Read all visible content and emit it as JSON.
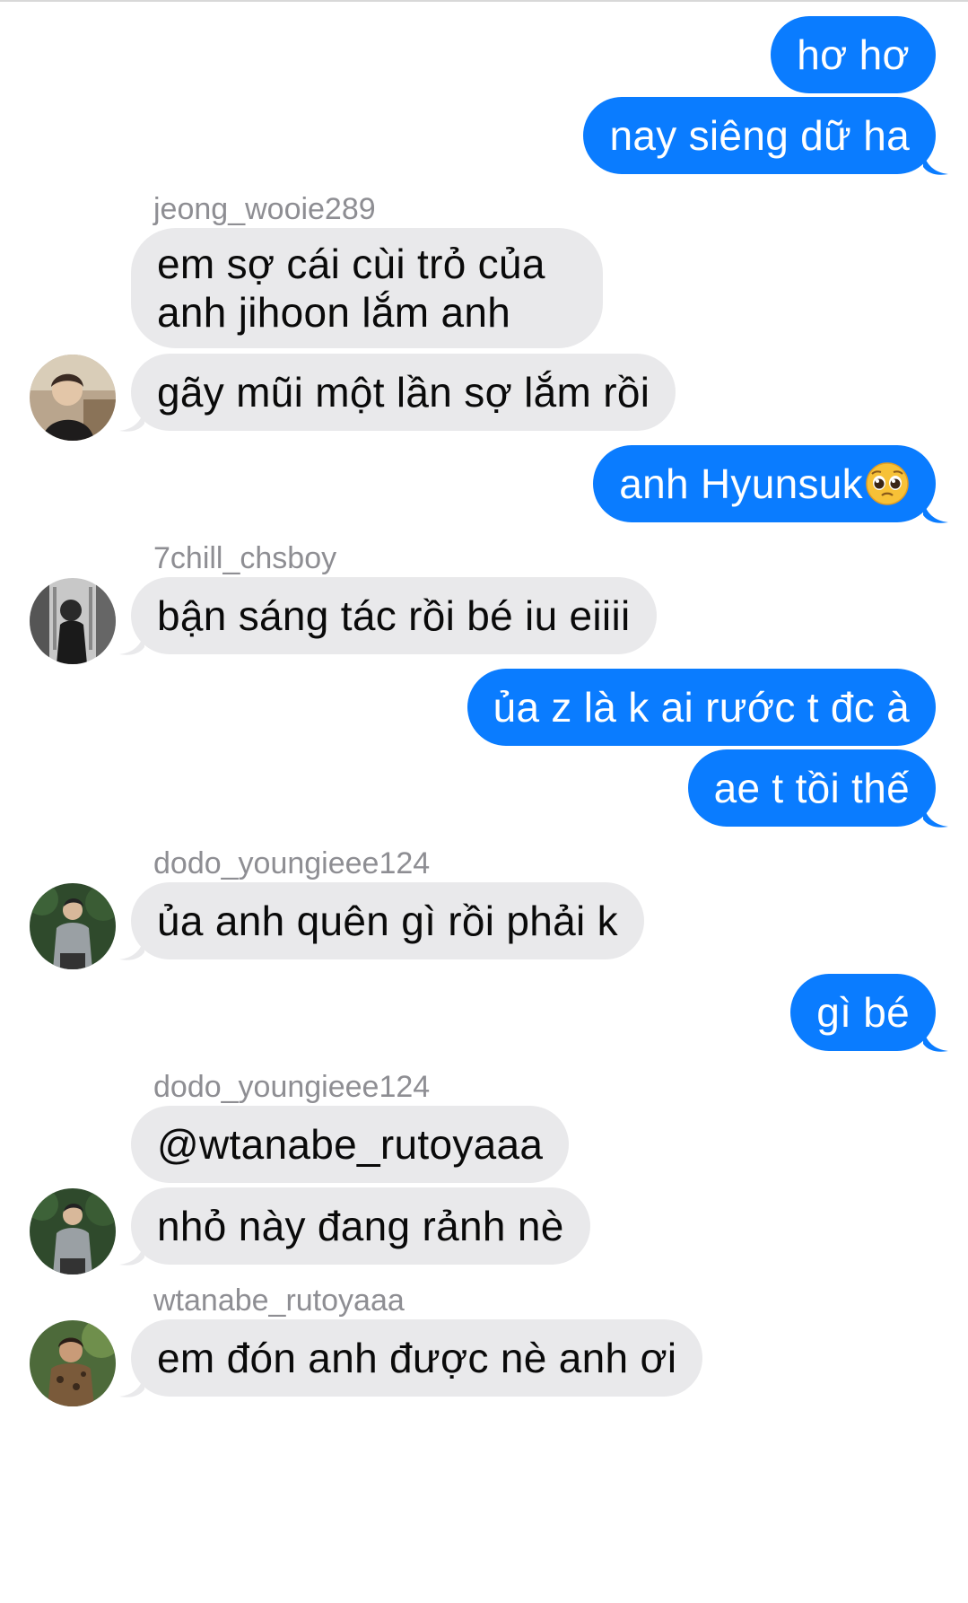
{
  "thread": {
    "messages": [
      {
        "id": "m1",
        "direction": "out",
        "text": "hơ hơ"
      },
      {
        "id": "m2",
        "direction": "out",
        "text": "nay siêng dữ ha"
      },
      {
        "id": "m3",
        "direction": "in",
        "sender": "jeong_wooie289",
        "text": "em sợ cái cùi trỏ của anh jihoon lắm anh"
      },
      {
        "id": "m4",
        "direction": "in",
        "text": "gãy mũi một lần sợ lắm rồi"
      },
      {
        "id": "m5",
        "direction": "out",
        "text": "anh Hyunsuk",
        "emoji": "pleading-face-emoji"
      },
      {
        "id": "m6",
        "direction": "in",
        "sender": "7chill_chsboy",
        "text": "bận sáng tác rồi bé iu eiiii"
      },
      {
        "id": "m7",
        "direction": "out",
        "text": "ủa z là k ai rước t đc à"
      },
      {
        "id": "m8",
        "direction": "out",
        "text": "ae t tồi thế"
      },
      {
        "id": "m9",
        "direction": "in",
        "sender": "dodo_youngieee124",
        "text": "ủa anh quên gì rồi phải k"
      },
      {
        "id": "m10",
        "direction": "out",
        "text": "gì bé"
      },
      {
        "id": "m11",
        "direction": "in",
        "sender": "dodo_youngieee124",
        "text": "@wtanabe_rutoyaaa"
      },
      {
        "id": "m12",
        "direction": "in",
        "text": "nhỏ này đang rảnh nè"
      },
      {
        "id": "m13",
        "direction": "in",
        "sender": "wtanabe_rutoyaaa",
        "text": "em đón anh được nè anh ơi"
      }
    ]
  },
  "colors": {
    "outgoing_bubble": "#0a7cff",
    "incoming_bubble": "#e9e9eb",
    "sender_name": "#8e8e93"
  },
  "icons": {
    "avatar_style": "user-photo-avatar",
    "emoji": "pleading-face-emoji"
  }
}
